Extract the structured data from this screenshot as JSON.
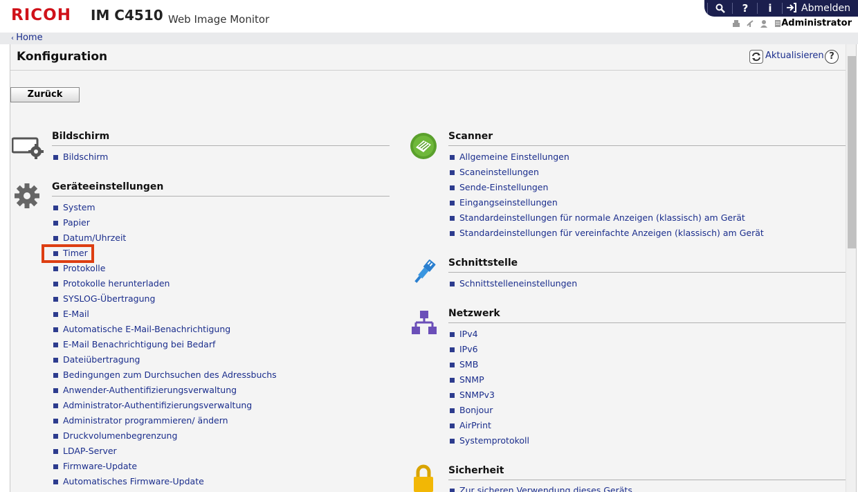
{
  "header": {
    "brand": "RICOH",
    "model": "IM C4510",
    "product": "Web Image Monitor",
    "topbar": {
      "search_icon": "search-icon",
      "help_icon": "help-icon",
      "info_icon": "info-icon",
      "logout_label": "Abmelden"
    },
    "user": "Administrator"
  },
  "breadcrumb": {
    "home": "Home"
  },
  "page": {
    "title": "Konfiguration",
    "refresh_label": "Aktualisieren",
    "back_label": "Zurück"
  },
  "sections": {
    "bildschirm": {
      "title": "Bildschirm",
      "icon": "screen-settings-icon",
      "links": [
        "Bildschirm"
      ]
    },
    "geraet": {
      "title": "Geräteeinstellungen",
      "icon": "gear-icon",
      "links": [
        "System",
        "Papier",
        "Datum/Uhrzeit",
        "Timer",
        "Protokolle",
        "Protokolle herunterladen",
        "SYSLOG-Übertragung",
        "E-Mail",
        "Automatische E-Mail-Benachrichtigung",
        "E-Mail Benachrichtigung bei Bedarf",
        "Dateiübertragung",
        "Bedingungen zum Durchsuchen des Adressbuchs",
        "Anwender-Authentifizierungsverwaltung",
        "Administrator-Authentifizierungsverwaltung",
        "Administrator programmieren/ ändern",
        "Druckvolumenbegrenzung",
        "LDAP-Server",
        "Firmware-Update",
        "Automatisches Firmware-Update"
      ]
    },
    "scanner": {
      "title": "Scanner",
      "icon": "scanner-icon",
      "links": [
        "Allgemeine Einstellungen",
        "Scaneinstellungen",
        "Sende-Einstellungen",
        "Eingangseinstellungen",
        "Standardeinstellungen für normale Anzeigen (klassisch) am Gerät",
        "Standardeinstellungen für vereinfachte Anzeigen (klassisch) am Gerät"
      ]
    },
    "schnittstelle": {
      "title": "Schnittstelle",
      "icon": "cable-icon",
      "links": [
        "Schnittstelleneinstellungen"
      ]
    },
    "netzwerk": {
      "title": "Netzwerk",
      "icon": "network-icon",
      "links": [
        "IPv4",
        "IPv6",
        "SMB",
        "SNMP",
        "SNMPv3",
        "Bonjour",
        "AirPrint",
        "Systemprotokoll"
      ]
    },
    "sicherheit": {
      "title": "Sicherheit",
      "icon": "lock-icon",
      "links": [
        "Zur sicheren Verwendung dieses Geräts"
      ]
    }
  },
  "highlight": {
    "item": "Timer",
    "color": "#dd3e12"
  },
  "colors": {
    "brand": "#d0121a",
    "topbar": "#1b1f4e",
    "link": "#1a2d8c"
  }
}
